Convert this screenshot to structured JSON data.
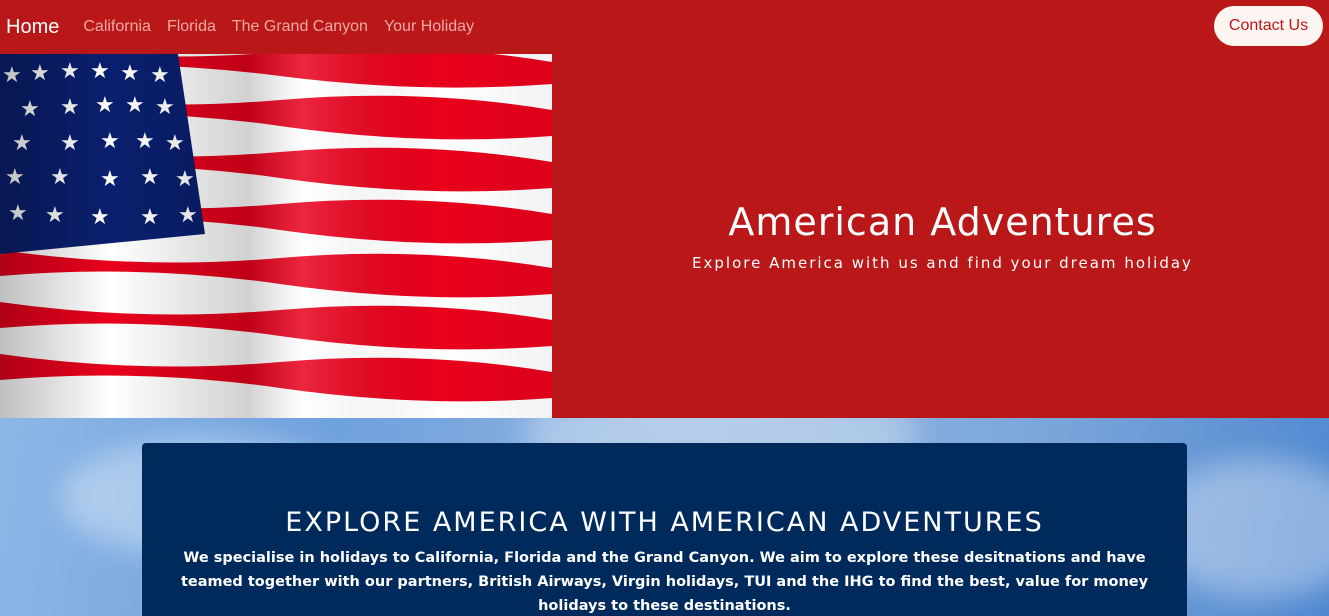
{
  "nav": {
    "brand": "Home",
    "links": [
      "California",
      "Florida",
      "The Grand Canyon",
      "Your Holiday"
    ],
    "contact_label": "Contact Us"
  },
  "hero": {
    "title": "American Adventures",
    "subtitle": "Explore America with us and find your dream holiday",
    "image": "us-flag-image"
  },
  "about": {
    "title": "EXPLORE AMERICA WITH AMERICAN ADVENTURES",
    "body": "We specialise in holidays to California, Florida and the Grand Canyon. We aim to explore these desitnations and have teamed together with our partners, British Airways, Virgin holidays, TUI and the IHG to find the best, value for money holidays to these destinations."
  },
  "colors": {
    "brand_red": "#b91718",
    "panel_navy": "#002a5c",
    "sky_blue": "#7ea8dc"
  }
}
